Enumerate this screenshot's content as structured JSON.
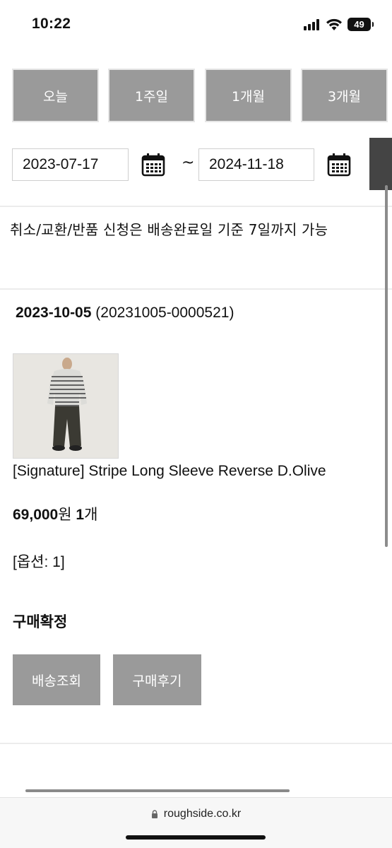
{
  "status_bar": {
    "time": "10:22",
    "battery": "49"
  },
  "period_buttons": [
    "오늘",
    "1주일",
    "1개월",
    "3개월"
  ],
  "date_range": {
    "start": "2023-07-17",
    "separator": "~",
    "end": "2024-11-18"
  },
  "notice": "취소/교환/반품 신청은 배송완료일 기준 7일까지 가능",
  "order": {
    "date": "2023-10-05",
    "number": "(20231005-0000521)",
    "product_name": "[Signature] Stripe Long Sleeve Reverse D.Olive",
    "price": "69,000",
    "price_unit": "원",
    "quantity": "1",
    "quantity_unit": "개",
    "option": "[옵션: 1]",
    "status": "구매확정",
    "actions": [
      "배송조회",
      "구매후기"
    ]
  },
  "browser": {
    "url": "roughside.co.kr"
  },
  "colors": {
    "button_gray": "#9a9a9a",
    "search_dark": "#444444"
  }
}
